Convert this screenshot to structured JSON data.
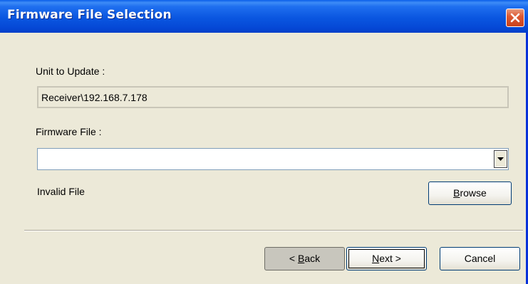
{
  "window": {
    "title": "Firmware File Selection"
  },
  "unit": {
    "label": "Unit to Update :",
    "value": "Receiver\\192.168.7.178"
  },
  "firmware": {
    "label": "Firmware File :",
    "value": "",
    "status": "Invalid File"
  },
  "buttons": {
    "browse_prefix": "B",
    "browse_rest": "rowse",
    "back_pre": "< ",
    "back_access": "B",
    "back_rest": "ack",
    "next_access": "N",
    "next_rest": "ext >",
    "cancel": "Cancel"
  },
  "colors": {
    "titlebar": "#0a56e0",
    "close": "#de5a33",
    "dialog_bg": "#ece9d8"
  },
  "icons": {
    "close": "close-icon",
    "dropdown": "chevron-down-icon"
  }
}
